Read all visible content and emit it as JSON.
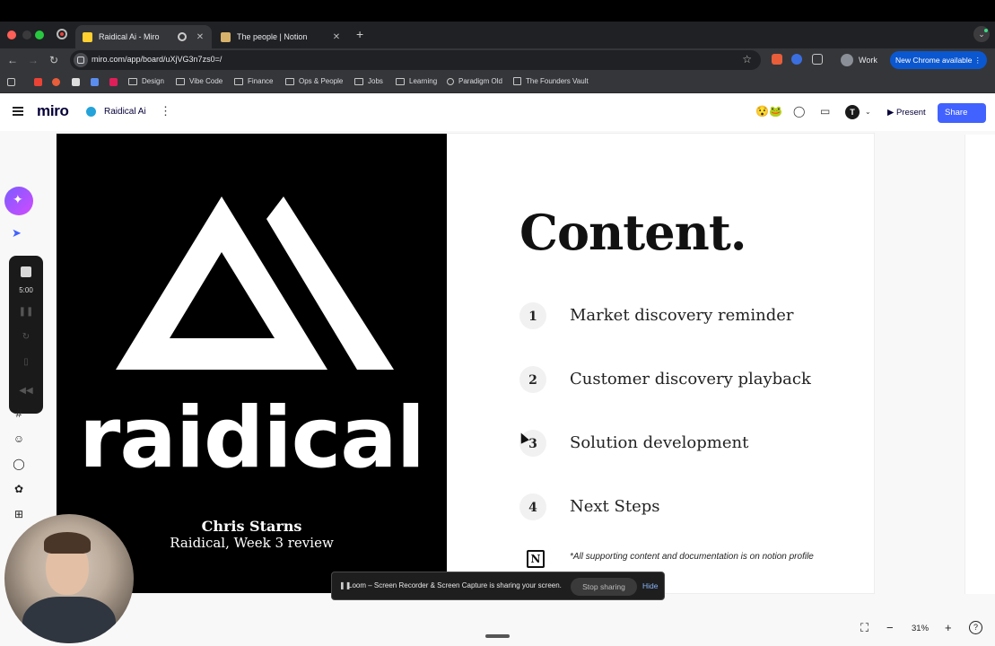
{
  "browser": {
    "tabs": [
      {
        "title": "Raidical Ai - Miro",
        "active": true
      },
      {
        "title": "The people | Notion",
        "active": false
      }
    ],
    "url": "miro.com/app/board/uXjVG3n7zs0=/",
    "profile_label": "Work",
    "update_label": "New Chrome available",
    "bookmarks": [
      "Design",
      "Vibe Code",
      "Finance",
      "Ops & People",
      "Jobs",
      "Learning",
      "Paradigm Old",
      "The Founders Vault"
    ]
  },
  "miro": {
    "logo": "miro",
    "board_name": "Raidical Ai",
    "reaction_label": "😯🐸",
    "user_initial": "T",
    "present_label": "Present",
    "share_label": "Share",
    "accent_color": "#4262ff"
  },
  "slide": {
    "wordmark": "raidical",
    "author": "Chris Starns",
    "subtitle": "Raidical, Week 3 review",
    "heading": "Content.",
    "items": [
      {
        "num": "1",
        "label": "Market discovery reminder"
      },
      {
        "num": "2",
        "label": "Customer discovery playback"
      },
      {
        "num": "3",
        "label": "Solution development"
      },
      {
        "num": "4",
        "label": "Next Steps"
      }
    ],
    "notion_glyph": "N",
    "note": "*All supporting content and documentation is on notion profile"
  },
  "recorder": {
    "time": "5:00"
  },
  "loom": {
    "message": "Loom – Screen Recorder & Screen Capture is sharing your screen.",
    "stop_label": "Stop sharing",
    "hide_label": "Hide"
  },
  "zoom": {
    "level": "31%"
  }
}
